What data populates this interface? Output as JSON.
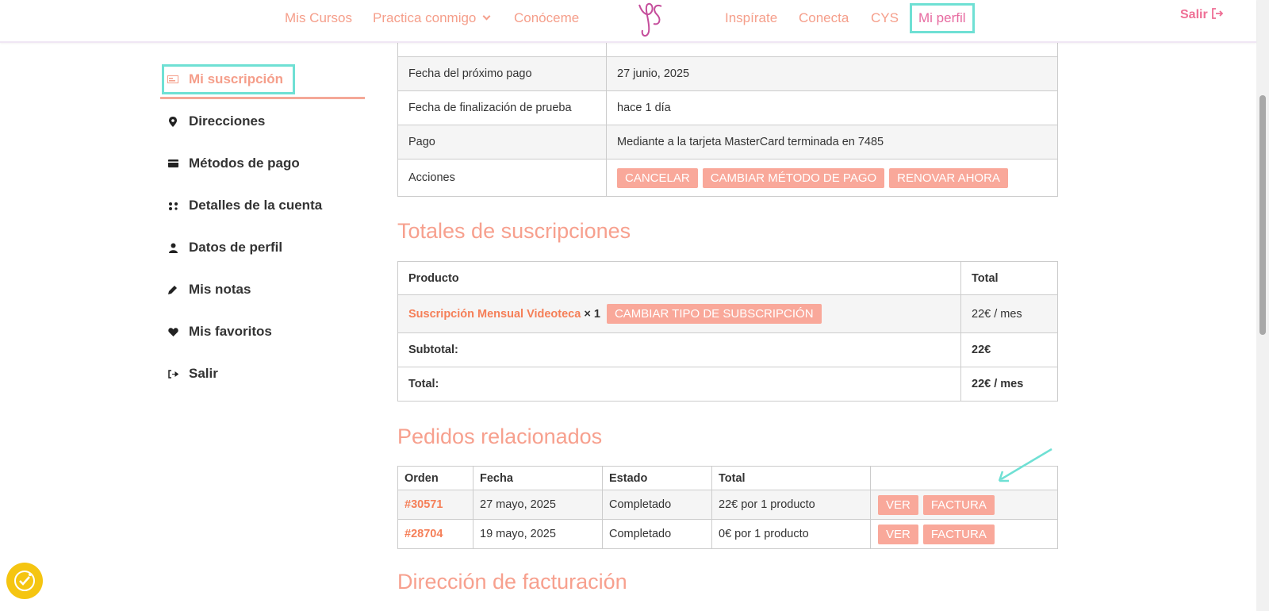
{
  "nav": {
    "mis_cursos": "Mis Cursos",
    "practica": "Practica conmigo",
    "conoceme": "Conóceme",
    "inspirate": "Inspírate",
    "conecta": "Conecta",
    "cys": "CYS",
    "mi_perfil": "Mi perfil",
    "salir": "Salir"
  },
  "sidebar": {
    "items": [
      {
        "label": "Mi suscripción",
        "icon": "subscription-icon"
      },
      {
        "label": "Direcciones",
        "icon": "map-pin-icon"
      },
      {
        "label": "Métodos de pago",
        "icon": "credit-card-icon"
      },
      {
        "label": "Detalles de la cuenta",
        "icon": "users-icon"
      },
      {
        "label": "Datos de perfil",
        "icon": "user-icon"
      },
      {
        "label": "Mis notas",
        "icon": "pencil-icon"
      },
      {
        "label": "Mis favoritos",
        "icon": "heart-icon"
      },
      {
        "label": "Salir",
        "icon": "logout-icon"
      }
    ]
  },
  "subscription": {
    "rows": [
      {
        "key": "Fecha del próximo pago",
        "value": "27 junio, 2025"
      },
      {
        "key": "Fecha de finalización de prueba",
        "value": "hace 1 día"
      },
      {
        "key": "Pago",
        "value": "Mediante a la tarjeta MasterCard terminada en 7485"
      }
    ],
    "actions_label": "Acciones",
    "actions": [
      "CANCELAR",
      "CAMBIAR MÉTODO DE PAGO",
      "RENOVAR AHORA"
    ]
  },
  "totals": {
    "heading": "Totales de suscripciones",
    "col_product": "Producto",
    "col_total": "Total",
    "product_name": "Suscripción Mensual Videoteca",
    "product_qty": "× 1",
    "change_btn": "CAMBIAR TIPO DE SUBSCRIPCIÓN",
    "product_total": "22€ / mes",
    "subtotal_label": "Subtotal:",
    "subtotal_value": "22€",
    "total_label": "Total:",
    "total_value": "22€ / mes"
  },
  "orders": {
    "heading": "Pedidos relacionados",
    "columns": [
      "Orden",
      "Fecha",
      "Estado",
      "Total",
      ""
    ],
    "rows": [
      {
        "order": "#30571",
        "date": "27 mayo, 2025",
        "status": "Completado",
        "total": "22€ por 1 producto",
        "view": "VER",
        "invoice": "FACTURA"
      },
      {
        "order": "#28704",
        "date": "19 mayo, 2025",
        "status": "Completado",
        "total": "0€ por 1 producto",
        "view": "VER",
        "invoice": "FACTURA"
      }
    ]
  },
  "billing": {
    "heading": "Dirección de facturación"
  },
  "colors": {
    "accent": "#f59e8a",
    "button": "#f9a89a",
    "highlight": "#6fe0d4",
    "link": "#f57f58"
  }
}
